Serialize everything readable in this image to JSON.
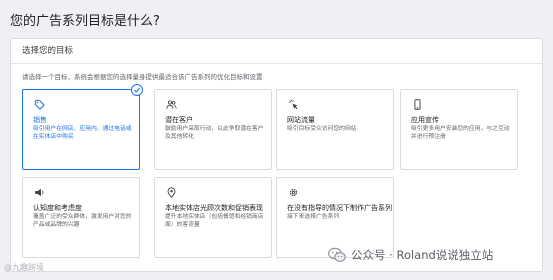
{
  "page": {
    "title": "您的广告系列目标是什么?"
  },
  "panel": {
    "header": "选择您的目标",
    "hint": "请选择一个目标，系统会根据您的选择量身提供最适合该广告系列的优化目标和设置"
  },
  "goals": [
    {
      "icon": "tag-icon",
      "title": "销售",
      "desc": "吸引用户在网店、应用内、通过电话或在实体店中购买",
      "selected": true
    },
    {
      "icon": "users-icon",
      "title": "潜在客户",
      "desc": "鼓励用户采取行动，以此争取潜在客户及其他转化",
      "selected": false
    },
    {
      "icon": "cursor-click-icon",
      "title": "网站流量",
      "desc": "吸引目标受众访问您的网站",
      "selected": false
    },
    {
      "icon": "phone-icon",
      "title": "应用宣传",
      "desc": "吸引更多用户安装您的应用，与之互动并进行预注册",
      "selected": false
    },
    {
      "icon": "megaphone-icon",
      "title": "认知度和考虑度",
      "desc": "覆盖广泛的受众群体，激发用户对您的产品或品牌的兴趣",
      "selected": false
    },
    {
      "icon": "location-pin-icon",
      "title": "本地实体店光顾次数和促销表现",
      "desc": "提升本地实体店（包括餐馆和经销商店面）的客流量",
      "selected": false
    },
    {
      "icon": "gear-icon",
      "title": "在没有指导的情况下制作广告系列",
      "desc": "接下来选择广告系列",
      "selected": false
    }
  ],
  "footer": {
    "left": "@九趣跨境"
  },
  "watermark": {
    "text": "公众号 · Roland说说独立站"
  },
  "colors": {
    "accent": "#1a73e8",
    "border": "#dadce0",
    "background": "#eef0f3"
  }
}
